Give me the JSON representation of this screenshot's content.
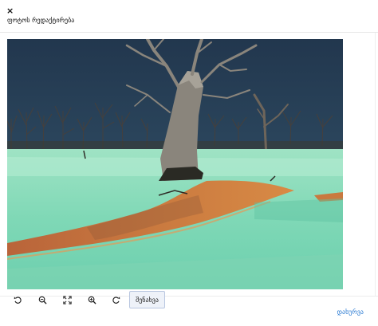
{
  "dialog": {
    "close_label": "×",
    "title": "ფოტოს რედაქტირება"
  },
  "toolbar": {
    "tools": [
      {
        "icon": "rotate-left-icon"
      },
      {
        "icon": "zoom-out-icon"
      },
      {
        "icon": "fit-screen-icon"
      },
      {
        "icon": "zoom-in-icon"
      },
      {
        "icon": "rotate-right-icon"
      }
    ],
    "save_label": "შენახვა"
  },
  "footer": {
    "done_label": "დახურვა"
  },
  "colors": {
    "accent": "#2b7bd3",
    "save_button_border": "#b8c6e0",
    "save_button_bg": "#eef2f9"
  }
}
